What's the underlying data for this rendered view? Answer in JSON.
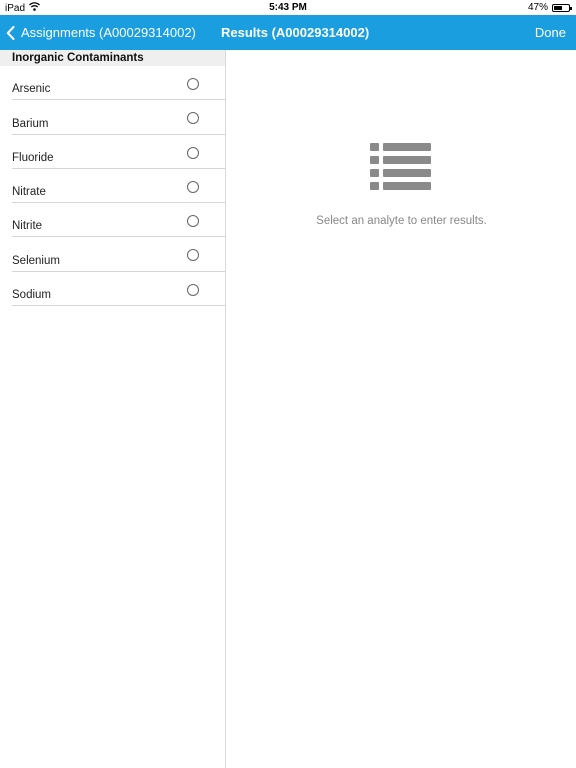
{
  "status_bar": {
    "device": "iPad",
    "time": "5:43 PM",
    "battery": "47%",
    "battery_level": 0.47
  },
  "nav": {
    "back_label": "Assignments (A00029314002)",
    "title": "Results (A00029314002)",
    "done_label": "Done",
    "accent_color": "#1a9ee0"
  },
  "sidebar": {
    "section_title": "Inorganic Contaminants",
    "items": [
      {
        "label": "Arsenic",
        "selected": false
      },
      {
        "label": "Barium",
        "selected": false
      },
      {
        "label": "Fluoride",
        "selected": false
      },
      {
        "label": "Nitrate",
        "selected": false
      },
      {
        "label": "Nitrite",
        "selected": false
      },
      {
        "label": "Selenium",
        "selected": false
      },
      {
        "label": "Sodium",
        "selected": false
      }
    ]
  },
  "main": {
    "icon": "list-icon",
    "empty_message": "Select an analyte to enter results."
  }
}
